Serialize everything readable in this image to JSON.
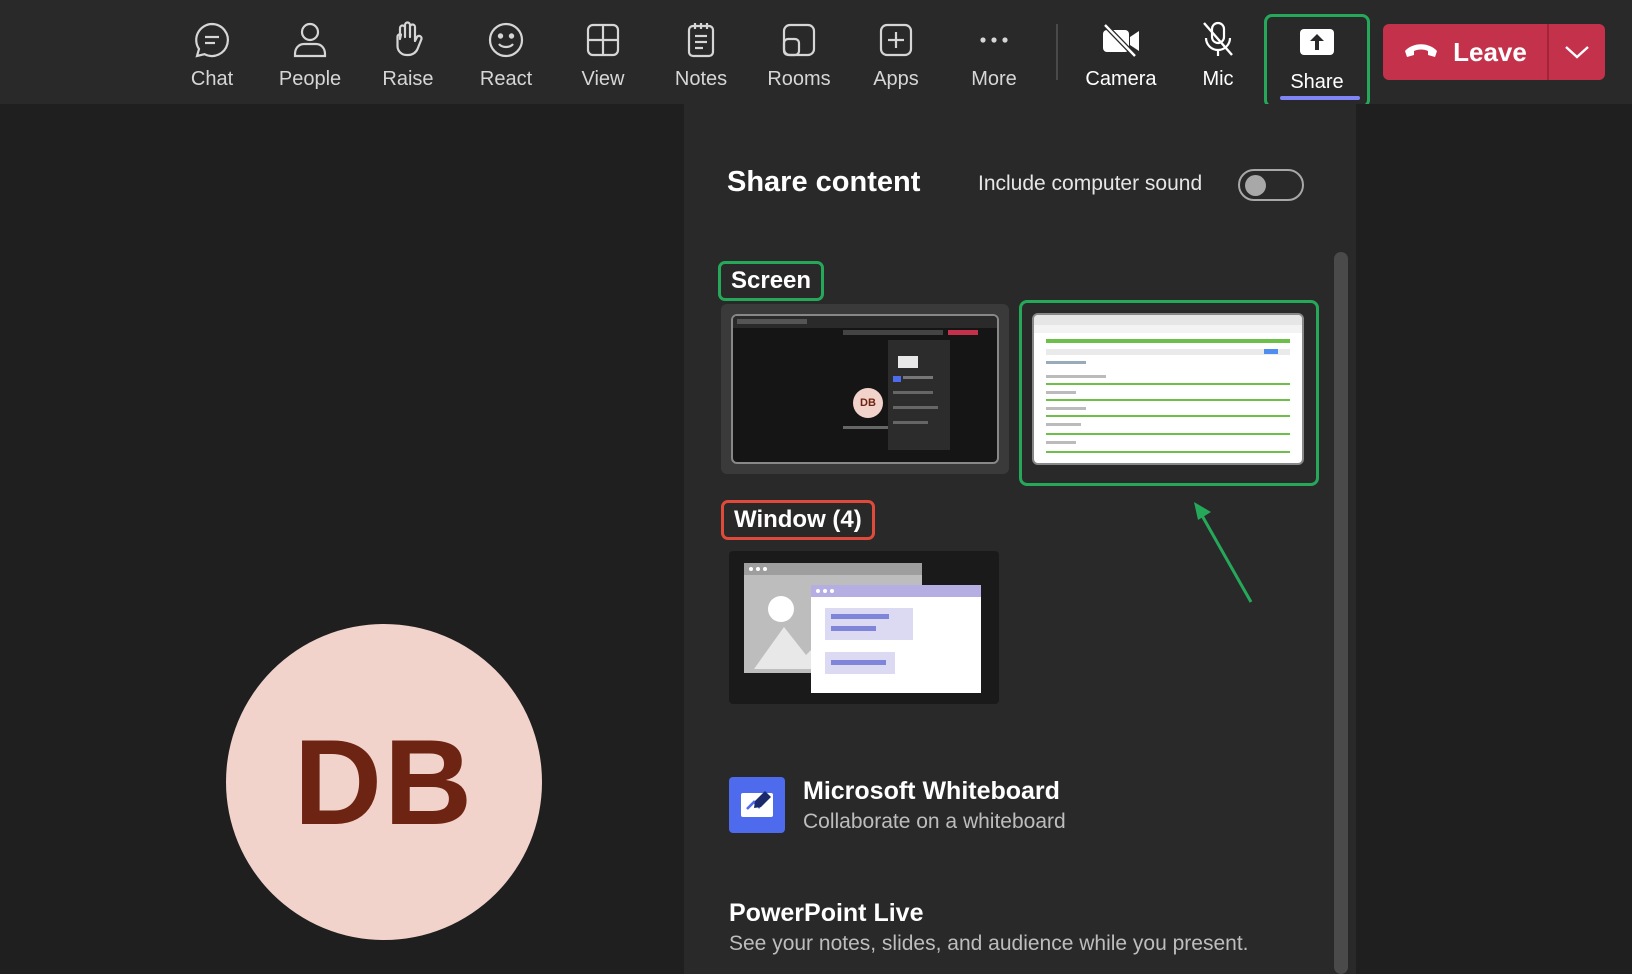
{
  "toolbar": {
    "items": [
      {
        "label": "Chat",
        "icon": "chat-icon"
      },
      {
        "label": "People",
        "icon": "person-icon"
      },
      {
        "label": "Raise",
        "icon": "raise-hand-icon"
      },
      {
        "label": "React",
        "icon": "smiley-icon"
      },
      {
        "label": "View",
        "icon": "grid-view-icon"
      },
      {
        "label": "Notes",
        "icon": "notes-icon"
      },
      {
        "label": "Rooms",
        "icon": "rooms-icon"
      },
      {
        "label": "Apps",
        "icon": "apps-add-icon"
      },
      {
        "label": "More",
        "icon": "ellipsis-icon"
      }
    ],
    "camera_label": "Camera",
    "mic_label": "Mic",
    "share_label": "Share",
    "leave_label": "Leave"
  },
  "participant": {
    "initials": "DB"
  },
  "share_panel": {
    "title": "Share content",
    "sound_label": "Include computer sound",
    "sound_enabled": false,
    "screen_label": "Screen",
    "window_label": "Window (4)",
    "mini_initials": "DB",
    "apps": [
      {
        "title": "Microsoft Whiteboard",
        "subtitle": "Collaborate on a whiteboard"
      },
      {
        "title": "PowerPoint Live",
        "subtitle": "See your notes, slides, and audience while you present."
      }
    ]
  },
  "colors": {
    "toolbar_bg": "#292929",
    "stage_bg": "#1f1f1f",
    "leave_red": "#c4314b",
    "highlight_green": "#26a85a",
    "highlight_red": "#e04a3a",
    "avatar_bg": "#f1d3cb",
    "avatar_text": "#6e2413",
    "share_underline": "#7f85f5"
  }
}
